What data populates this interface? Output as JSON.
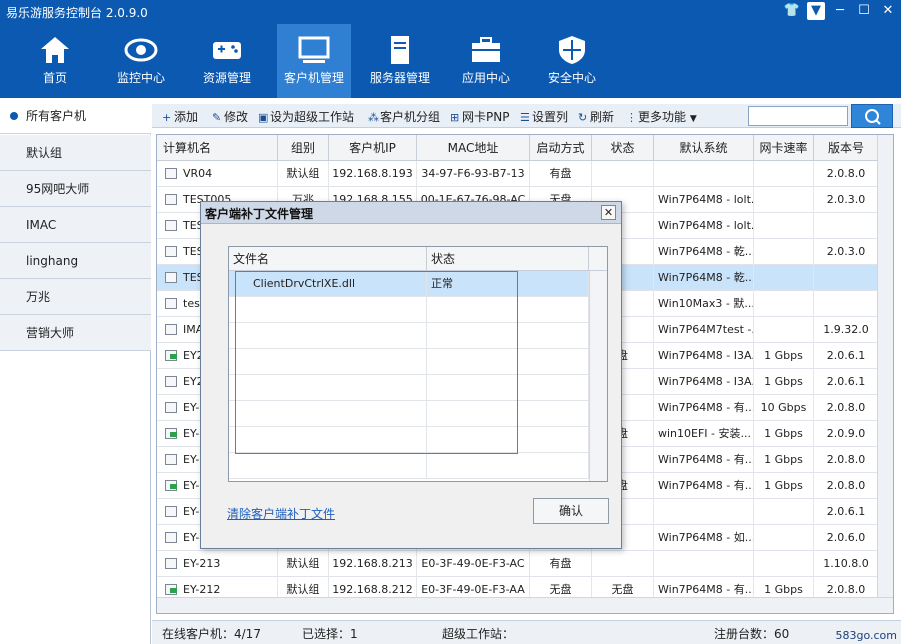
{
  "app": {
    "title": "易乐游服务控制台 2.0.9.0"
  },
  "nav": [
    {
      "label": "首页",
      "icon": "home-icon"
    },
    {
      "label": "监控中心",
      "icon": "eye-icon"
    },
    {
      "label": "资源管理",
      "icon": "gamepad-icon"
    },
    {
      "label": "客户机管理",
      "icon": "monitor-icon",
      "active": true
    },
    {
      "label": "服务器管理",
      "icon": "server-icon"
    },
    {
      "label": "应用中心",
      "icon": "toolbox-icon"
    },
    {
      "label": "安全中心",
      "icon": "shield-icon"
    }
  ],
  "sidebar": [
    {
      "label": "所有客户机",
      "active": true
    },
    {
      "label": "默认组"
    },
    {
      "label": "95网吧大师"
    },
    {
      "label": "IMAC"
    },
    {
      "label": "linghang"
    },
    {
      "label": "万兆"
    },
    {
      "label": "营销大师"
    }
  ],
  "toolbar": [
    {
      "label": "添加",
      "icon": "plus-icon"
    },
    {
      "label": "修改",
      "icon": "edit-icon"
    },
    {
      "label": "设为超级工作站",
      "icon": "station-icon"
    },
    {
      "label": "客户机分组",
      "icon": "group-icon"
    },
    {
      "label": "网卡PNP",
      "icon": "nic-icon"
    },
    {
      "label": "设置列",
      "icon": "columns-icon"
    },
    {
      "label": "刷新",
      "icon": "refresh-icon"
    },
    {
      "label": "更多功能",
      "icon": "more-icon"
    }
  ],
  "grid": {
    "columns": [
      "计算机名",
      "组别",
      "客户机IP",
      "MAC地址",
      "启动方式",
      "状态",
      "默认系统",
      "网卡速率",
      "版本号"
    ],
    "rows": [
      {
        "name": "VR04",
        "group": "默认组",
        "ip": "192.168.8.193",
        "mac": "34-97-F6-93-B7-13",
        "boot": "有盘",
        "status": "",
        "sys": "",
        "speed": "",
        "ver": "2.0.8.0",
        "online": false
      },
      {
        "name": "TEST005",
        "group": "万兆",
        "ip": "192.168.8.155",
        "mac": "00-1E-67-76-98-AC",
        "boot": "无盘",
        "status": "",
        "sys": "Win7P64M8 - lolt...",
        "speed": "",
        "ver": "2.0.3.0",
        "online": false
      },
      {
        "name": "TES",
        "group": "",
        "ip": "",
        "mac": "",
        "boot": "",
        "status": "",
        "sys": "Win7P64M8 - lolt...",
        "speed": "",
        "ver": "",
        "online": false
      },
      {
        "name": "TES",
        "group": "",
        "ip": "",
        "mac": "",
        "boot": "",
        "status": "",
        "sys": "Win7P64M8 - 乾...",
        "speed": "",
        "ver": "2.0.3.0",
        "online": false
      },
      {
        "name": "TES",
        "group": "",
        "ip": "",
        "mac": "",
        "boot": "",
        "status": "",
        "sys": "Win7P64M8 - 乾...",
        "speed": "",
        "ver": "",
        "online": false,
        "selected": true
      },
      {
        "name": "test",
        "group": "",
        "ip": "",
        "mac": "",
        "boot": "",
        "status": "",
        "sys": "Win10Max3 - 默...",
        "speed": "",
        "ver": "",
        "online": false
      },
      {
        "name": "IMA",
        "group": "",
        "ip": "",
        "mac": "",
        "boot": "",
        "status": "",
        "sys": "Win7P64M7test -...",
        "speed": "",
        "ver": "1.9.32.0",
        "online": false
      },
      {
        "name": "EY2",
        "group": "",
        "ip": "",
        "mac": "",
        "boot": "",
        "status": "盘",
        "sys": "Win7P64M8 - I3A...",
        "speed": "1 Gbps",
        "ver": "2.0.6.1",
        "online": true
      },
      {
        "name": "EY2",
        "group": "",
        "ip": "",
        "mac": "",
        "boot": "",
        "status": "",
        "sys": "Win7P64M8 - I3A...",
        "speed": "1 Gbps",
        "ver": "2.0.6.1",
        "online": false
      },
      {
        "name": "EY-",
        "group": "",
        "ip": "",
        "mac": "",
        "boot": "",
        "status": "",
        "sys": "Win7P64M8 - 有...",
        "speed": "10 Gbps",
        "ver": "2.0.8.0",
        "online": false
      },
      {
        "name": "EY-",
        "group": "",
        "ip": "",
        "mac": "",
        "boot": "",
        "status": "盘",
        "sys": "win10EFI - 安装...",
        "speed": "1 Gbps",
        "ver": "2.0.9.0",
        "online": true
      },
      {
        "name": "EY-",
        "group": "",
        "ip": "",
        "mac": "",
        "boot": "",
        "status": "",
        "sys": "Win7P64M8 - 有...",
        "speed": "1 Gbps",
        "ver": "2.0.8.0",
        "online": false
      },
      {
        "name": "EY-",
        "group": "",
        "ip": "",
        "mac": "",
        "boot": "",
        "status": "盘",
        "sys": "Win7P64M8 - 有...",
        "speed": "1 Gbps",
        "ver": "2.0.8.0",
        "online": true
      },
      {
        "name": "EY-",
        "group": "",
        "ip": "",
        "mac": "",
        "boot": "",
        "status": "",
        "sys": "",
        "speed": "",
        "ver": "2.0.6.1",
        "online": false
      },
      {
        "name": "EY-",
        "group": "",
        "ip": "",
        "mac": "",
        "boot": "",
        "status": "",
        "sys": "Win7P64M8 - 如...",
        "speed": "",
        "ver": "2.0.6.0",
        "online": false
      },
      {
        "name": "EY-213",
        "group": "默认组",
        "ip": "192.168.8.213",
        "mac": "E0-3F-49-0E-F3-AC",
        "boot": "有盘",
        "status": "",
        "sys": "",
        "speed": "",
        "ver": "1.10.8.0",
        "online": false
      },
      {
        "name": "EY-212",
        "group": "默认组",
        "ip": "192.168.8.212",
        "mac": "E0-3F-49-0E-F3-AA",
        "boot": "无盘",
        "status": "无盘",
        "sys": "Win7P64M8 - 有...",
        "speed": "1 Gbps",
        "ver": "2.0.8.0",
        "online": true
      }
    ]
  },
  "status": {
    "online": "在线客户机：4/17",
    "selected": "已选择：1",
    "super": "超级工作站：",
    "registered": "注册台数：60",
    "watermark": "583go.com"
  },
  "dialog": {
    "title": "客户端补丁文件管理",
    "columns": [
      "文件名",
      "状态"
    ],
    "rows": [
      {
        "file": "ClientDrvCtrlXE.dll",
        "state": "正常"
      }
    ],
    "clear_link": "清除客户端补丁文件",
    "ok_label": "确认"
  }
}
